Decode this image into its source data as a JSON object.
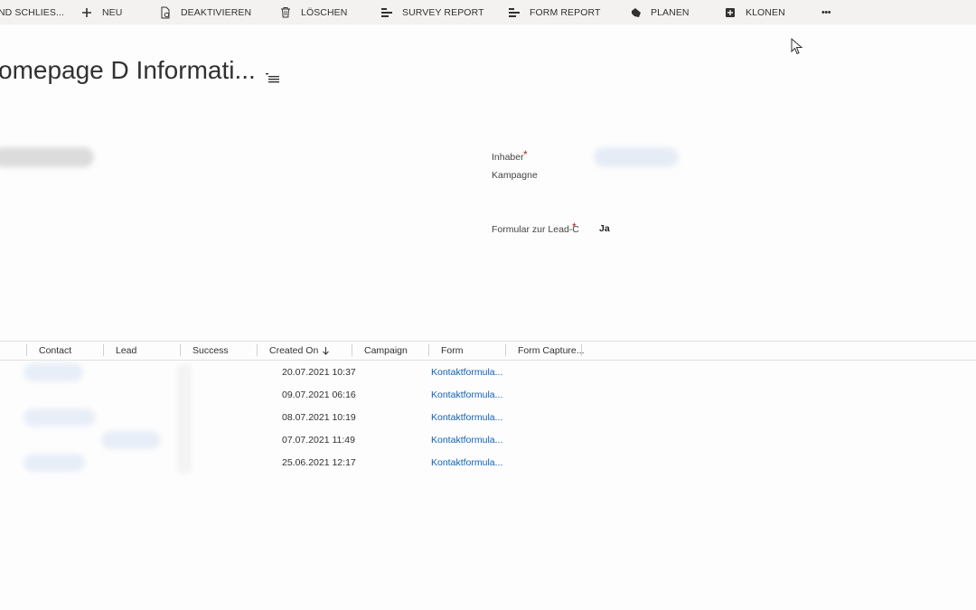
{
  "commandbar": {
    "items": [
      {
        "label": "ND SCHLIES...",
        "icon": "none"
      },
      {
        "label": "NEU",
        "icon": "plus-icon"
      },
      {
        "label": "DEAKTIVIEREN",
        "icon": "deactivate-icon"
      },
      {
        "label": "LÖSCHEN",
        "icon": "trash-icon"
      },
      {
        "label": "SURVEY REPORT",
        "icon": "report-icon"
      },
      {
        "label": "FORM REPORT",
        "icon": "report-icon"
      },
      {
        "label": "PLANEN",
        "icon": "hand-icon"
      },
      {
        "label": "KLONEN",
        "icon": "clone-icon"
      },
      {
        "label": "•••",
        "icon": "more-icon"
      }
    ]
  },
  "header": {
    "title": "omepage D Informati..."
  },
  "form": {
    "owner_label": "Inhaber",
    "owner_required": "*",
    "campaign_label": "Kampagne",
    "lead_form_label": "Formular zur Lead-C",
    "lead_form_required": "*",
    "lead_form_value": "Ja"
  },
  "grid": {
    "columns": [
      "Contact",
      "Lead",
      "Success",
      "Created On",
      "Campaign",
      "Form",
      "Form Capture..."
    ],
    "sort_icon": "arrow-down-icon",
    "rows": [
      {
        "created_on": "20.07.2021 10:37",
        "form": "Kontaktformula..."
      },
      {
        "created_on": "09.07.2021 06:16",
        "form": "Kontaktformula..."
      },
      {
        "created_on": "08.07.2021 10:19",
        "form": "Kontaktformula..."
      },
      {
        "created_on": "07.07.2021 11:49",
        "form": "Kontaktformula..."
      },
      {
        "created_on": "25.06.2021 12:17",
        "form": "Kontaktformula..."
      }
    ]
  },
  "colors": {
    "commandbar_bg": "#f3f2f1",
    "link": "#1160b7",
    "required": "#a4262c"
  }
}
